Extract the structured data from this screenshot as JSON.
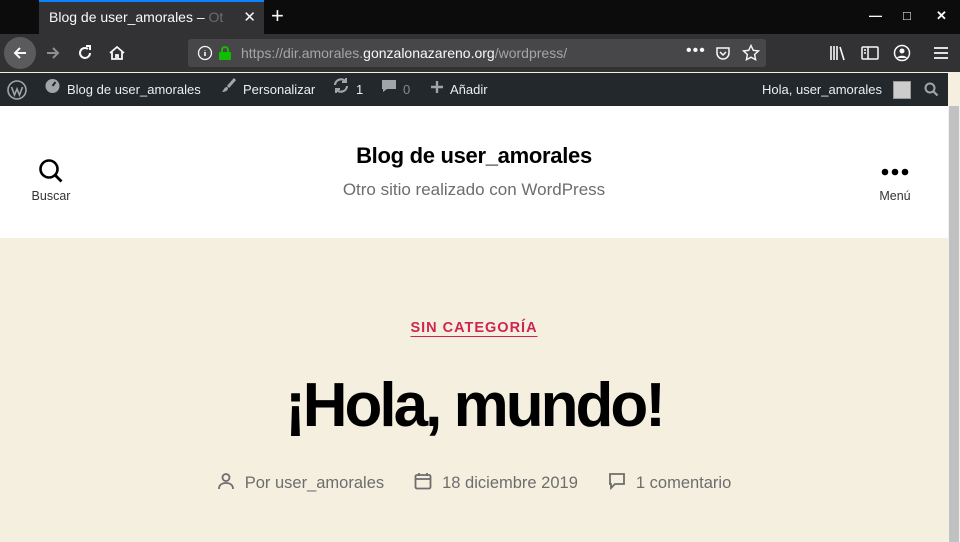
{
  "browser": {
    "tab_title": "Blog de user_amorales – ",
    "tab_title_fade": "Ot",
    "url_prefix": "https://dir.amorales.",
    "url_domain": "gonzalonazareno.org",
    "url_suffix": "/wordpress/",
    "icons": [
      "back-icon",
      "forward-icon",
      "reload-icon",
      "home-icon",
      "info-icon",
      "lock-icon",
      "more-icon",
      "pocket-icon",
      "bookmark-star-icon",
      "library-icon",
      "sidebar-icon",
      "account-icon",
      "menu-icon"
    ]
  },
  "adminbar": {
    "site_name": "Blog de user_amorales",
    "customize": "Personalizar",
    "updates_count": "1",
    "comments_count": "0",
    "add_new": "Añadir",
    "greeting": "Hola, user_amorales"
  },
  "header": {
    "search_label": "Buscar",
    "site_title": "Blog de user_amorales",
    "site_description": "Otro sitio realizado con WordPress",
    "menu_label": "Menú"
  },
  "post": {
    "category": "SIN CATEGORÍA",
    "title": "¡Hola, mundo!",
    "author": "Por user_amorales",
    "date": "18 diciembre 2019",
    "comments": "1 comentario"
  },
  "colors": {
    "accent": "#cd2653",
    "background": "#f5efe0",
    "adminbar": "#23282d",
    "chrome": "#323234"
  }
}
